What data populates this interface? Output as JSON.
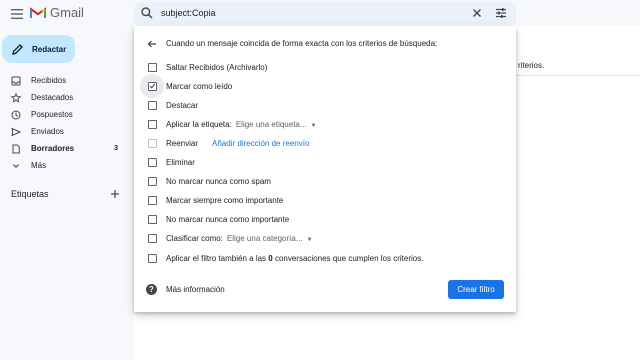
{
  "app": {
    "name": "Gmail"
  },
  "search": {
    "value": "subject:Copia"
  },
  "compose": {
    "label": "Redactar"
  },
  "nav": {
    "items": [
      {
        "label": "Recibidos",
        "icon": "inbox-icon",
        "bold": false,
        "count": ""
      },
      {
        "label": "Destacados",
        "icon": "star-icon",
        "bold": false,
        "count": ""
      },
      {
        "label": "Pospuestos",
        "icon": "clock-icon",
        "bold": false,
        "count": ""
      },
      {
        "label": "Enviados",
        "icon": "send-icon",
        "bold": false,
        "count": ""
      },
      {
        "label": "Borradores",
        "icon": "draft-icon",
        "bold": true,
        "count": "3"
      },
      {
        "label": "Más",
        "icon": "chevron-down-icon",
        "bold": false,
        "count": ""
      }
    ],
    "labels_header": "Etiquetas"
  },
  "background": {
    "partial_text": "riterios."
  },
  "filter_panel": {
    "header": "Cuando un mensaje coincida de forma exacta con los criterios de búsqueda:",
    "options": [
      {
        "label": "Saltar Recibidos (Archivarlo)",
        "checked": false
      },
      {
        "label": "Marcar como leído",
        "checked": true
      },
      {
        "label": "Destacar",
        "checked": false
      },
      {
        "label": "Aplicar la etiqueta:",
        "checked": false,
        "select": "Elige una etiqueta..."
      },
      {
        "label": "Reenviar",
        "checked": false,
        "disabled": true,
        "link": "Añadir dirección de reenvío"
      },
      {
        "label": "Eliminar",
        "checked": false
      },
      {
        "label": "No marcar nunca como spam",
        "checked": false
      },
      {
        "label": "Marcar siempre como importante",
        "checked": false
      },
      {
        "label": "No marcar nunca como importante",
        "checked": false
      },
      {
        "label": "Clasificar como:",
        "checked": false,
        "select": "Elige una categoría..."
      }
    ],
    "apply_also": {
      "prefix": "Aplicar el filtro también a las ",
      "count": "0",
      "suffix": " conversaciones que cumplen los criterios."
    },
    "help_label": "Más información",
    "create_button": "Crear filtro"
  },
  "colors": {
    "accent": "#1a73e8",
    "compose_bg": "#c2e7ff",
    "search_bg": "#eaf1fb"
  }
}
